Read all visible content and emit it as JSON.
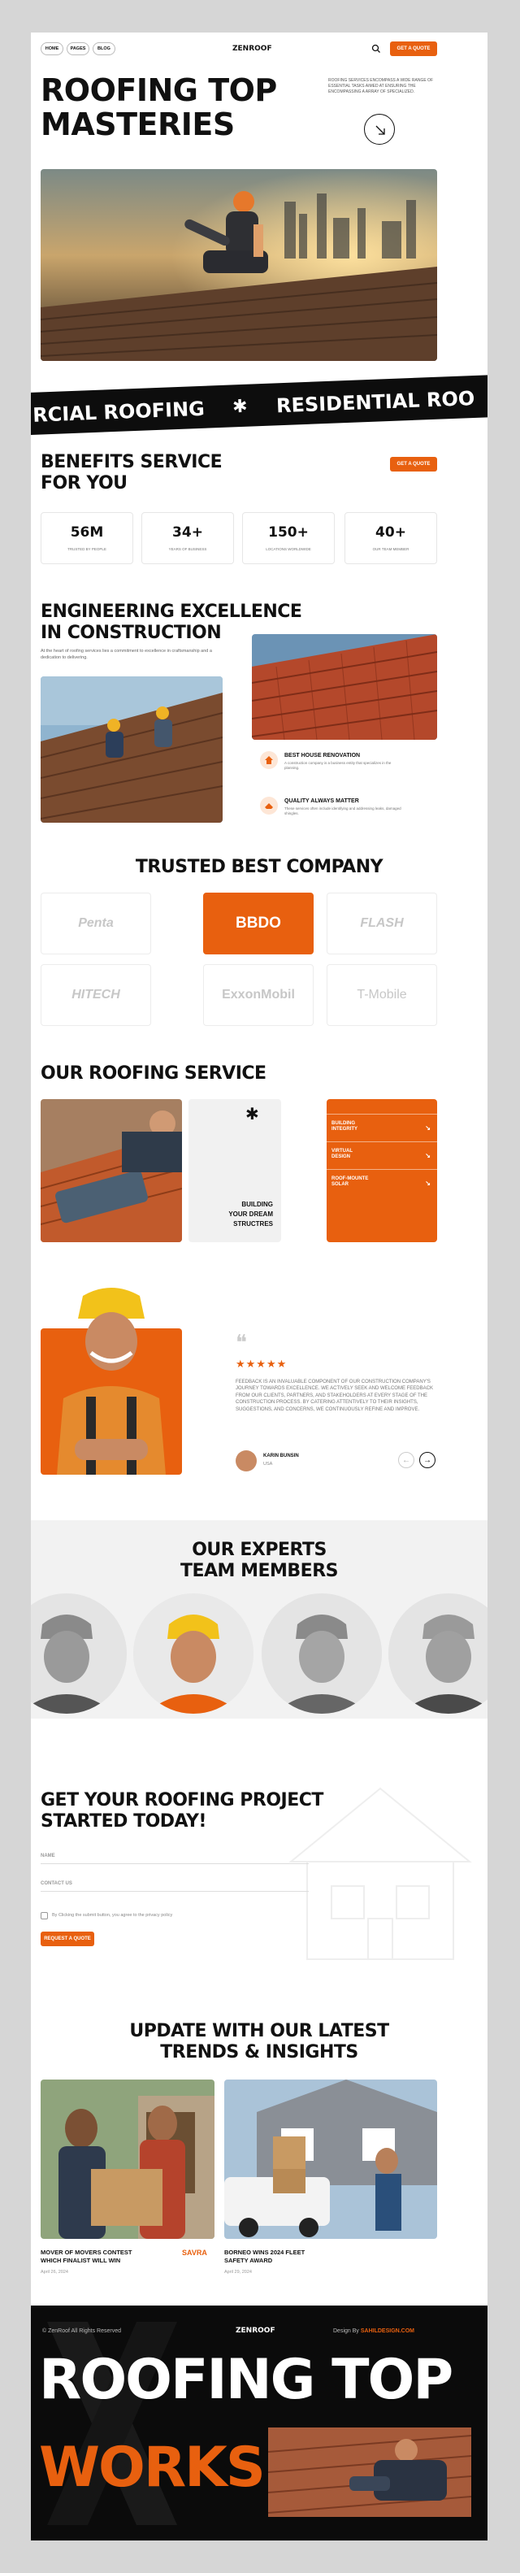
{
  "nav": {
    "links": [
      "HOME",
      "PAGES",
      "BLOG"
    ],
    "brand": "ZENROOF",
    "cta": "GET A QUOTE"
  },
  "hero": {
    "title_line1": "ROOFING TOP",
    "title_line2": "MASTERIES",
    "description": "ROOFING SERVICES ENCOMPASS A WIDE RANGE OF ESSENTIAL TASKS AIMED AT ENSURING THE ENCOMPASSING A ARRAY OF SPECIALIZED."
  },
  "marquee": {
    "left": "RCIAL ROOFING",
    "star": "✱",
    "right": "RESIDENTIAL ROO"
  },
  "benefits": {
    "title_line1": "BENEFITS SERVICE",
    "title_line2": "FOR YOU",
    "cta": "GET A QUOTE",
    "stats": [
      {
        "value": "56M",
        "label": "TRUSTED BY PEOPLE"
      },
      {
        "value": "34+",
        "label": "YEARS OF BUSINESS"
      },
      {
        "value": "150+",
        "label": "LOCATIONS WORLDWIDE"
      },
      {
        "value": "40+",
        "label": "OUR TEAM MEMBER"
      }
    ]
  },
  "engineering": {
    "title_line1": "ENGINEERING EXCELLENCE",
    "title_line2": "IN CONSTRUCTION",
    "description": "At the heart of roofing services lies a commitment to excellence in craftsmanship and a dedication to delivering.",
    "features": [
      {
        "title": "BEST HOUSE RENOVATION",
        "text": "A construction company is a business entity that specializes in the planning."
      },
      {
        "title": "QUALITY ALWAYS MATTER",
        "text": "These services often include identifying and addressing leaks, damaged shingles."
      }
    ]
  },
  "trusted": {
    "title": "TRUSTED BEST COMPANY",
    "logos": [
      "Penta",
      "BBDO",
      "FLASH",
      "HITECH",
      "ExxonMobil",
      "T-Mobile"
    ]
  },
  "service": {
    "title": "OUR ROOFING SERVICE",
    "card_text_line1": "BUILDING",
    "card_text_line2": "YOUR DREAM",
    "card_text_line3": "STRUCTRES",
    "items": [
      {
        "line1": "BUILDING",
        "line2": "INTEGRITY"
      },
      {
        "line1": "VIRTUAL",
        "line2": "DESIGN"
      },
      {
        "line1": "ROOF-MOUNTE",
        "line2": "SOLAR"
      }
    ],
    "arrow": "↘"
  },
  "testimonial": {
    "quote_mark": "❝",
    "stars": "★★★★★",
    "text": "FEEDBACK IS AN INVALUABLE COMPONENT OF OUR CONSTRUCTION COMPANY'S JOURNEY TOWARDS EXCELLENCE. WE ACTIVELY SEEK AND WELCOME FEEDBACK FROM OUR CLIENTS, PARTNERS, AND STAKEHOLDERS AT EVERY STAGE OF THE CONSTRUCTION PROCESS. BY CATERING ATTENTIVELY TO THEIR INSIGHTS, SUGGESTIONS, AND CONCERNS, WE CONTINUOUSLY REFINE AND IMPROVE.",
    "author": "KARIN BUNSIN",
    "location": "USA",
    "prev": "←",
    "next": "→"
  },
  "team": {
    "title_line1": "OUR EXPERTS",
    "title_line2": "TEAM MEMBERS"
  },
  "contact": {
    "title_line1": "GET YOUR ROOFING PROJECT",
    "title_line2": "STARTED TODAY!",
    "name_label": "NAME",
    "contact_label": "CONTACT US",
    "checkbox_label": "By Clicking the submit button, you agree to the privacy policy",
    "submit": "REQUEST A QUOTE"
  },
  "blog": {
    "title_line1": "UPDATE WITH OUR LATEST",
    "title_line2": "TRENDS & INSIGHTS",
    "posts": [
      {
        "title_line1": "MOVER OF MOVERS CONTEST",
        "title_line2": "WHICH FINALIST WILL WIN",
        "date": "April 26, 2024",
        "tag": "SAVRA"
      },
      {
        "title_line1": "BORNEO WINS 2024 FLEET",
        "title_line2": "SAFETY AWARD",
        "date": "April 29, 2024",
        "tag": ""
      }
    ]
  },
  "footer": {
    "copyright": "© ZenRoof All Rights Reserved",
    "brand": "ZENROOF",
    "credit_prefix": "Design By",
    "credit_link": "SAHILDESIGN.COM",
    "big_line1": "ROOFING TOP",
    "big_line2": "WORKS"
  },
  "colors": {
    "accent": "#e8600f",
    "dark": "#111111",
    "page_bg": "#d6d6d6"
  }
}
